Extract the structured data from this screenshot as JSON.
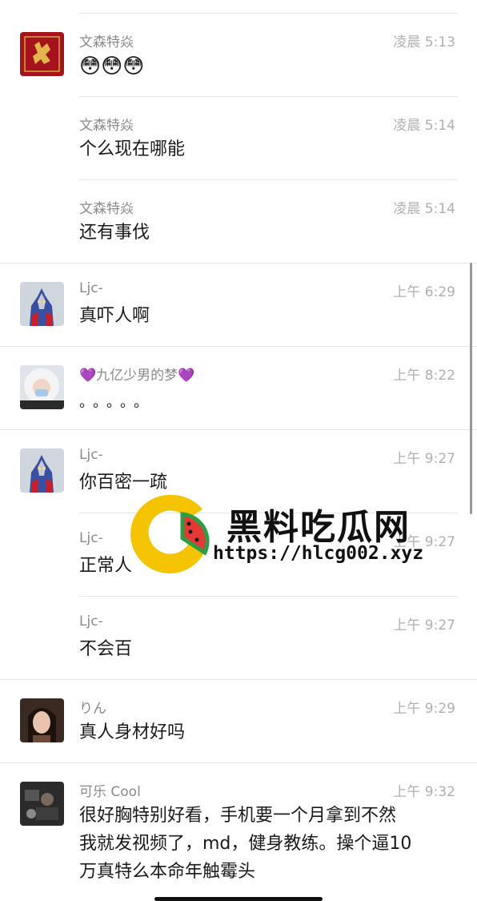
{
  "messages": [
    {
      "sender": "文森特焱",
      "time": "凌晨 5:13",
      "text": "😳😳😳",
      "avatar": "fu-avatar"
    },
    {
      "sender": "文森特焱",
      "time": "凌晨 5:14",
      "text": "个么现在哪能"
    },
    {
      "sender": "文森特焱",
      "time": "凌晨 5:14",
      "text": "还有事伐"
    },
    {
      "sender": "Ljc-",
      "time": "上午 6:29",
      "text": "真吓人啊",
      "avatar": "ultraman-avatar"
    },
    {
      "sender": "💜九亿少男的梦💜",
      "time": "上午 8:22",
      "text": "。。。。。",
      "avatar": "girl-furhood-avatar"
    },
    {
      "sender": "Ljc-",
      "time": "上午 9:27",
      "text": "你百密一疏",
      "avatar": "ultraman-avatar"
    },
    {
      "sender": "Ljc-",
      "time": "上午 9:27",
      "text": "正常人"
    },
    {
      "sender": "Ljc-",
      "time": "上午 9:27",
      "text": "不会百"
    },
    {
      "sender": "りん",
      "time": "上午 9:29",
      "text": "真人身材好吗",
      "avatar": "girl-portrait-avatar"
    },
    {
      "sender": "可乐 Cool",
      "time": "上午 9:32",
      "lines": [
        "很好胸特别好看，手机要一个月拿到不然",
        "我就发视频了，md，健身教练。操个逼10",
        "万真特么本命年触霉头"
      ],
      "avatar": "dark-photo-avatar"
    }
  ],
  "watermark": {
    "title": "黑料吃瓜网",
    "url": "https://hlcg002.xyz"
  },
  "colors": {
    "accent_yellow": "#f5c400",
    "watermelon_red": "#e53935",
    "watermelon_green": "#2e9e44"
  }
}
